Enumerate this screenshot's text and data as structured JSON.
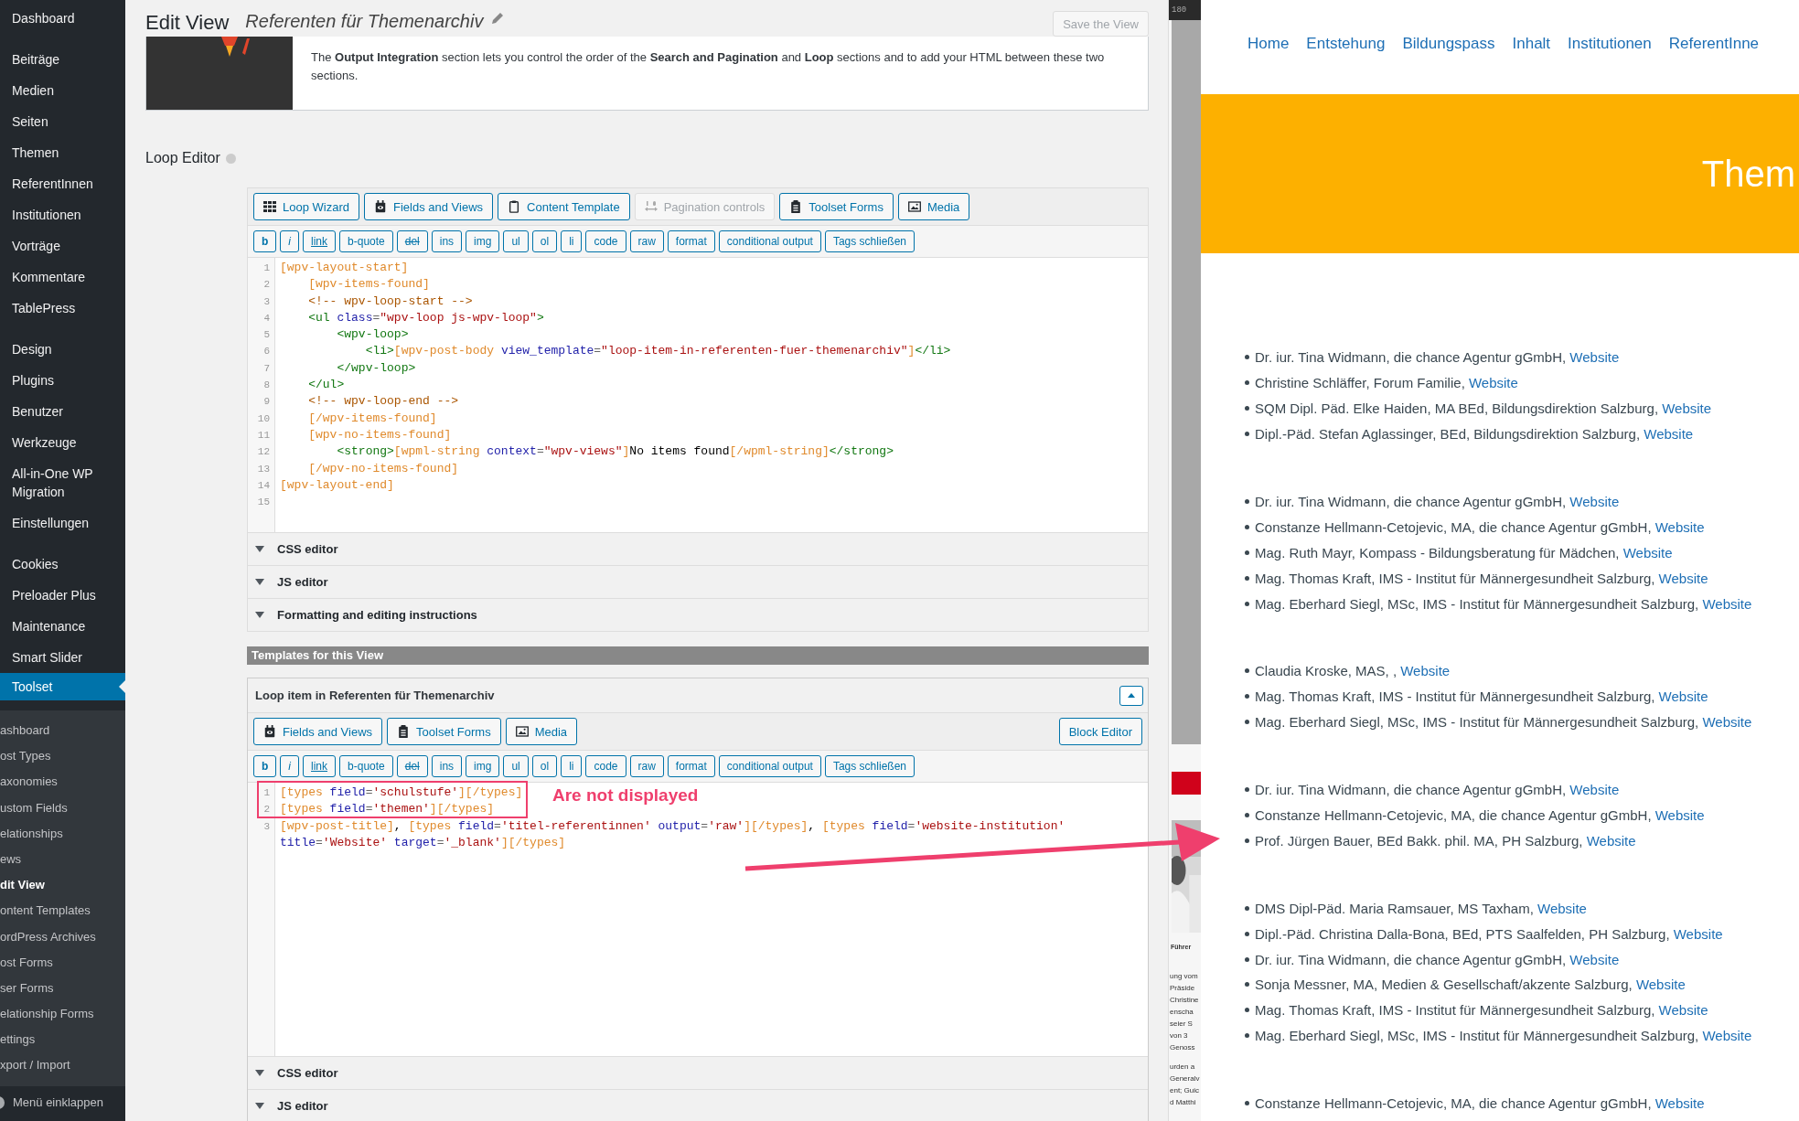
{
  "sidebar": {
    "groups": [
      {
        "items": [
          {
            "label": "Dashboard",
            "selected": false
          }
        ]
      },
      {
        "items": [
          {
            "label": "Beiträge",
            "selected": false
          },
          {
            "label": "Medien",
            "selected": false
          },
          {
            "label": "Seiten",
            "selected": false
          },
          {
            "label": "Themen",
            "selected": false
          },
          {
            "label": "ReferentInnen",
            "selected": false
          },
          {
            "label": "Institutionen",
            "selected": false
          },
          {
            "label": "Vorträge",
            "selected": false
          },
          {
            "label": "Kommentare",
            "selected": false
          },
          {
            "label": "TablePress",
            "selected": false
          }
        ]
      },
      {
        "items": [
          {
            "label": "Design",
            "selected": false
          },
          {
            "label": "Plugins",
            "selected": false
          },
          {
            "label": "Benutzer",
            "selected": false
          },
          {
            "label": "Werkzeuge",
            "selected": false
          },
          {
            "label": "All-in-One WP Migration",
            "selected": false
          },
          {
            "label": "Einstellungen",
            "selected": false
          }
        ]
      },
      {
        "items": [
          {
            "label": "Cookies",
            "selected": false
          },
          {
            "label": "Preloader Plus",
            "selected": false
          },
          {
            "label": "Maintenance",
            "selected": false
          },
          {
            "label": "Smart Slider",
            "selected": false
          },
          {
            "label": "Toolset",
            "selected": true
          }
        ]
      }
    ],
    "submenu": [
      {
        "label": "ashboard",
        "selected": false
      },
      {
        "label": "ost Types",
        "selected": false
      },
      {
        "label": "axonomies",
        "selected": false
      },
      {
        "label": "ustom Fields",
        "selected": false
      },
      {
        "label": "elationships",
        "selected": false
      },
      {
        "label": "ews",
        "selected": false
      },
      {
        "label": "dit View",
        "selected": true
      },
      {
        "label": "ontent Templates",
        "selected": false
      },
      {
        "label": "ordPress Archives",
        "selected": false
      },
      {
        "label": "ost Forms",
        "selected": false
      },
      {
        "label": "ser Forms",
        "selected": false
      },
      {
        "label": "elationship Forms",
        "selected": false
      },
      {
        "label": "ettings",
        "selected": false
      },
      {
        "label": "xport / Import",
        "selected": false
      }
    ],
    "collapse": "Menü einklappen"
  },
  "header": {
    "title": "Edit View",
    "view_name": "Referenten für Themenarchiv",
    "save_button": {
      "label": "Save the View",
      "disabled": true
    }
  },
  "info": {
    "text": "The **Output Integration** section lets you control the order of the **Search and Pagination** and **Loop** sections and to add your HTML between these two sections."
  },
  "loop_editor": {
    "title": "Loop Editor",
    "toolbar": [
      {
        "label": "Loop Wizard",
        "kind": "grid",
        "disabled": false
      },
      {
        "label": "Fields and Views",
        "kind": "camera",
        "disabled": false
      },
      {
        "label": "Content Template",
        "kind": "clipboard",
        "disabled": false
      },
      {
        "label": "Pagination controls",
        "kind": "pagination",
        "disabled": true
      },
      {
        "label": "Toolset Forms",
        "kind": "forms",
        "disabled": false
      },
      {
        "label": "Media",
        "kind": "media",
        "disabled": false
      }
    ],
    "format_buttons": [
      {
        "label": "b",
        "kind": "bold"
      },
      {
        "label": "i",
        "kind": "italic"
      },
      {
        "label": "link",
        "kind": "underline"
      },
      {
        "label": "b-quote",
        "kind": "plain"
      },
      {
        "label": "del",
        "kind": "strike"
      },
      {
        "label": "ins",
        "kind": "plain"
      },
      {
        "label": "img",
        "kind": "plain"
      },
      {
        "label": "ul",
        "kind": "plain"
      },
      {
        "label": "ol",
        "kind": "plain"
      },
      {
        "label": "li",
        "kind": "plain"
      },
      {
        "label": "code",
        "kind": "plain"
      },
      {
        "label": "raw",
        "kind": "plain"
      },
      {
        "label": "format",
        "kind": "plain"
      },
      {
        "label": "conditional output",
        "kind": "plain"
      },
      {
        "label": "Tags schließen",
        "kind": "plain"
      }
    ],
    "code": [
      {
        "number": "1",
        "tokens": [
          {
            "kind": "shortcode",
            "text": "[wpv-layout-start]"
          }
        ]
      },
      {
        "number": "2",
        "tokens": [
          {
            "kind": "shortcode",
            "text": "    [wpv-items-found]"
          }
        ]
      },
      {
        "number": "3",
        "tokens": [
          {
            "kind": "comment",
            "text": "    <!-- wpv-loop-start -->"
          }
        ]
      },
      {
        "number": "4",
        "tokens": [
          {
            "kind": "tag",
            "text": "    <ul "
          },
          {
            "kind": "attr",
            "text": "class"
          },
          {
            "kind": "op",
            "text": "="
          },
          {
            "kind": "string",
            "text": "\"wpv-loop js-wpv-loop\""
          },
          {
            "kind": "tag",
            "text": ">"
          }
        ]
      },
      {
        "number": "5",
        "tokens": [
          {
            "kind": "tag",
            "text": "        <wpv-loop>"
          }
        ]
      },
      {
        "number": "6",
        "tokens": [
          {
            "kind": "tag",
            "text": "            <li>"
          },
          {
            "kind": "shortcode",
            "text": "[wpv-post-body "
          },
          {
            "kind": "attr",
            "text": "view_template"
          },
          {
            "kind": "op",
            "text": "="
          },
          {
            "kind": "string",
            "text": "\"loop-item-in-referenten-fuer-themenarchiv\""
          },
          {
            "kind": "shortcode",
            "text": "]"
          },
          {
            "kind": "tag",
            "text": "</li>"
          }
        ]
      },
      {
        "number": "7",
        "tokens": [
          {
            "kind": "tag",
            "text": "        </wpv-loop>"
          }
        ]
      },
      {
        "number": "8",
        "tokens": [
          {
            "kind": "tag",
            "text": "    </ul>"
          }
        ]
      },
      {
        "number": "9",
        "tokens": [
          {
            "kind": "comment",
            "text": "    <!-- wpv-loop-end -->"
          }
        ]
      },
      {
        "number": "10",
        "tokens": [
          {
            "kind": "shortcode",
            "text": "    [/wpv-items-found]"
          }
        ]
      },
      {
        "number": "11",
        "tokens": [
          {
            "kind": "shortcode",
            "text": "    [wpv-no-items-found]"
          }
        ]
      },
      {
        "number": "12",
        "tokens": [
          {
            "kind": "tag",
            "text": "        <strong>"
          },
          {
            "kind": "shortcode",
            "text": "[wpml-string "
          },
          {
            "kind": "attr",
            "text": "context"
          },
          {
            "kind": "op",
            "text": "="
          },
          {
            "kind": "string",
            "text": "\"wpv-views\""
          },
          {
            "kind": "shortcode",
            "text": "]"
          },
          {
            "kind": "text",
            "text": "No items found"
          },
          {
            "kind": "shortcode",
            "text": "[/wpml-string]"
          },
          {
            "kind": "tag",
            "text": "</strong>"
          }
        ]
      },
      {
        "number": "13",
        "tokens": [
          {
            "kind": "shortcode",
            "text": "    [/wpv-no-items-found]"
          }
        ]
      },
      {
        "number": "14",
        "tokens": [
          {
            "kind": "shortcode",
            "text": "[wpv-layout-end]"
          }
        ]
      },
      {
        "number": "15"
      }
    ],
    "sections": [
      {
        "label": "CSS editor"
      },
      {
        "label": "JS editor"
      },
      {
        "label": "Formatting and editing instructions"
      }
    ]
  },
  "templates_bar": "Templates for this View",
  "template": {
    "title": "Loop item in Referenten für Themenarchiv",
    "toolbar": [
      {
        "label": "Fields and Views",
        "kind": "camera",
        "disabled": false
      },
      {
        "label": "Toolset Forms",
        "kind": "forms",
        "disabled": false
      },
      {
        "label": "Media",
        "kind": "media",
        "disabled": false
      }
    ],
    "block_editor": "Block Editor",
    "format_buttons": [
      {
        "label": "b",
        "kind": "bold"
      },
      {
        "label": "i",
        "kind": "italic"
      },
      {
        "label": "link",
        "kind": "underline"
      },
      {
        "label": "b-quote",
        "kind": "plain"
      },
      {
        "label": "del",
        "kind": "strike"
      },
      {
        "label": "ins",
        "kind": "plain"
      },
      {
        "label": "img",
        "kind": "plain"
      },
      {
        "label": "ul",
        "kind": "plain"
      },
      {
        "label": "ol",
        "kind": "plain"
      },
      {
        "label": "li",
        "kind": "plain"
      },
      {
        "label": "code",
        "kind": "plain"
      },
      {
        "label": "raw",
        "kind": "plain"
      },
      {
        "label": "format",
        "kind": "plain"
      },
      {
        "label": "conditional output",
        "kind": "plain"
      },
      {
        "label": "Tags schließen",
        "kind": "plain"
      }
    ],
    "code": [
      {
        "number": "1",
        "tokens": [
          {
            "kind": "shortcode",
            "text": "[types "
          },
          {
            "kind": "attr",
            "text": "field"
          },
          {
            "kind": "op",
            "text": "="
          },
          {
            "kind": "string",
            "text": "'schulstufe'"
          },
          {
            "kind": "shortcode",
            "text": "][/types]"
          }
        ]
      },
      {
        "number": "2",
        "tokens": [
          {
            "kind": "shortcode",
            "text": "[types "
          },
          {
            "kind": "attr",
            "text": "field"
          },
          {
            "kind": "op",
            "text": "="
          },
          {
            "kind": "string",
            "text": "'themen'"
          },
          {
            "kind": "shortcode",
            "text": "][/types]"
          }
        ]
      },
      {
        "number": "3",
        "tokens": [
          {
            "kind": "shortcode",
            "text": "[wpv-post-title]"
          },
          {
            "kind": "text",
            "text": ", "
          },
          {
            "kind": "shortcode",
            "text": "[types "
          },
          {
            "kind": "attr",
            "text": "field"
          },
          {
            "kind": "op",
            "text": "="
          },
          {
            "kind": "string",
            "text": "'titel-referentinnen'"
          },
          {
            "kind": "attr",
            "text": " output"
          },
          {
            "kind": "op",
            "text": "="
          },
          {
            "kind": "string",
            "text": "'raw'"
          },
          {
            "kind": "shortcode",
            "text": "][/types]"
          },
          {
            "kind": "text",
            "text": ", "
          },
          {
            "kind": "shortcode",
            "text": "[types "
          },
          {
            "kind": "attr",
            "text": "field"
          },
          {
            "kind": "op",
            "text": "="
          },
          {
            "kind": "string",
            "text": "'website-institution'"
          }
        ],
        "wrapped": [
          {
            "kind": "attr",
            "text": "title"
          },
          {
            "kind": "op",
            "text": "="
          },
          {
            "kind": "string",
            "text": "'Website'"
          },
          {
            "kind": "attr",
            "text": " target"
          },
          {
            "kind": "op",
            "text": "="
          },
          {
            "kind": "string",
            "text": "'_blank'"
          },
          {
            "kind": "shortcode",
            "text": "][/types]"
          }
        ]
      }
    ],
    "annotation": "Are not displayed",
    "sections": [
      {
        "label": "CSS editor"
      },
      {
        "label": "JS editor"
      }
    ]
  },
  "background_window": {
    "ruler": "180",
    "caption": "Führer",
    "fragments": [
      "ung vom",
      "Präside",
      "Christine",
      "enscha",
      "seier S",
      "von 3",
      "Genoss",
      "urden a",
      "Generalv",
      "ent; Guic",
      "d Matthi"
    ]
  },
  "preview": {
    "nav": [
      "Home",
      "Entstehung",
      "Bildungspass",
      "Inhalt",
      "Institutionen",
      "ReferentInne"
    ],
    "banner_title": "Them",
    "groups": [
      {
        "items": [
          {
            "text": "Dr. iur. Tina Widmann, die chance Agentur gGmbH, ",
            "link": "Website"
          },
          {
            "text": "Christine Schläffer, Forum Familie, ",
            "link": "Website"
          },
          {
            "text": "SQM Dipl. Päd. Elke Haiden, MA BEd, Bildungsdirektion Salzburg, ",
            "link": "Website"
          },
          {
            "text": "Dipl.-Päd. Stefan Aglassinger, BEd, Bildungsdirektion Salzburg, ",
            "link": "Website"
          }
        ]
      },
      {
        "items": [
          {
            "text": "Dr. iur. Tina Widmann, die chance Agentur gGmbH, ",
            "link": "Website"
          },
          {
            "text": "Constanze Hellmann-Cetojevic, MA, die chance Agentur gGmbH, ",
            "link": "Website"
          },
          {
            "text": "Mag. Ruth Mayr, Kompass - Bildungsberatung für Mädchen, ",
            "link": "Website"
          },
          {
            "text": "Mag. Thomas Kraft, IMS - Institut für Männergesundheit Salzburg, ",
            "link": "Website"
          },
          {
            "text": "Mag. Eberhard Siegl, MSc, IMS - Institut für Männergesundheit Salzburg, ",
            "link": "Website"
          }
        ]
      },
      {
        "items": [
          {
            "text": "Claudia Kroske, MAS, , ",
            "link": "Website"
          },
          {
            "text": "Mag. Thomas Kraft, IMS - Institut für Männergesundheit Salzburg, ",
            "link": "Website"
          },
          {
            "text": "Mag. Eberhard Siegl, MSc, IMS - Institut für Männergesundheit Salzburg, ",
            "link": "Website"
          }
        ]
      },
      {
        "items": [
          {
            "text": "Dr. iur. Tina Widmann, die chance Agentur gGmbH, ",
            "link": "Website"
          },
          {
            "text": "Constanze Hellmann-Cetojevic, MA, die chance Agentur gGmbH, ",
            "link": "Website"
          },
          {
            "text": "Prof. Jürgen Bauer, BEd Bakk. phil. MA, PH Salzburg, ",
            "link": "Website"
          }
        ]
      },
      {
        "items": [
          {
            "text": "DMS Dipl-Päd. Maria Ramsauer, MS Taxham, ",
            "link": "Website"
          },
          {
            "text": "Dipl.-Päd. Christina Dalla-Bona, BEd, PTS Saalfelden, PH Salzburg, ",
            "link": "Website"
          },
          {
            "text": "Dr. iur. Tina Widmann, die chance Agentur gGmbH, ",
            "link": "Website"
          },
          {
            "text": "Sonja Messner, MA, Medien & Gesellschaft/akzente Salzburg, ",
            "link": "Website"
          },
          {
            "text": "Mag. Thomas Kraft, IMS - Institut für Männergesundheit Salzburg, ",
            "link": "Website"
          },
          {
            "text": "Mag. Eberhard Siegl, MSc, IMS - Institut für Männergesundheit Salzburg, ",
            "link": "Website"
          }
        ]
      },
      {
        "items": [
          {
            "text": "Constanze Hellmann-Cetojevic, MA, die chance Agentur gGmbH, ",
            "link": "Website"
          }
        ]
      }
    ]
  }
}
